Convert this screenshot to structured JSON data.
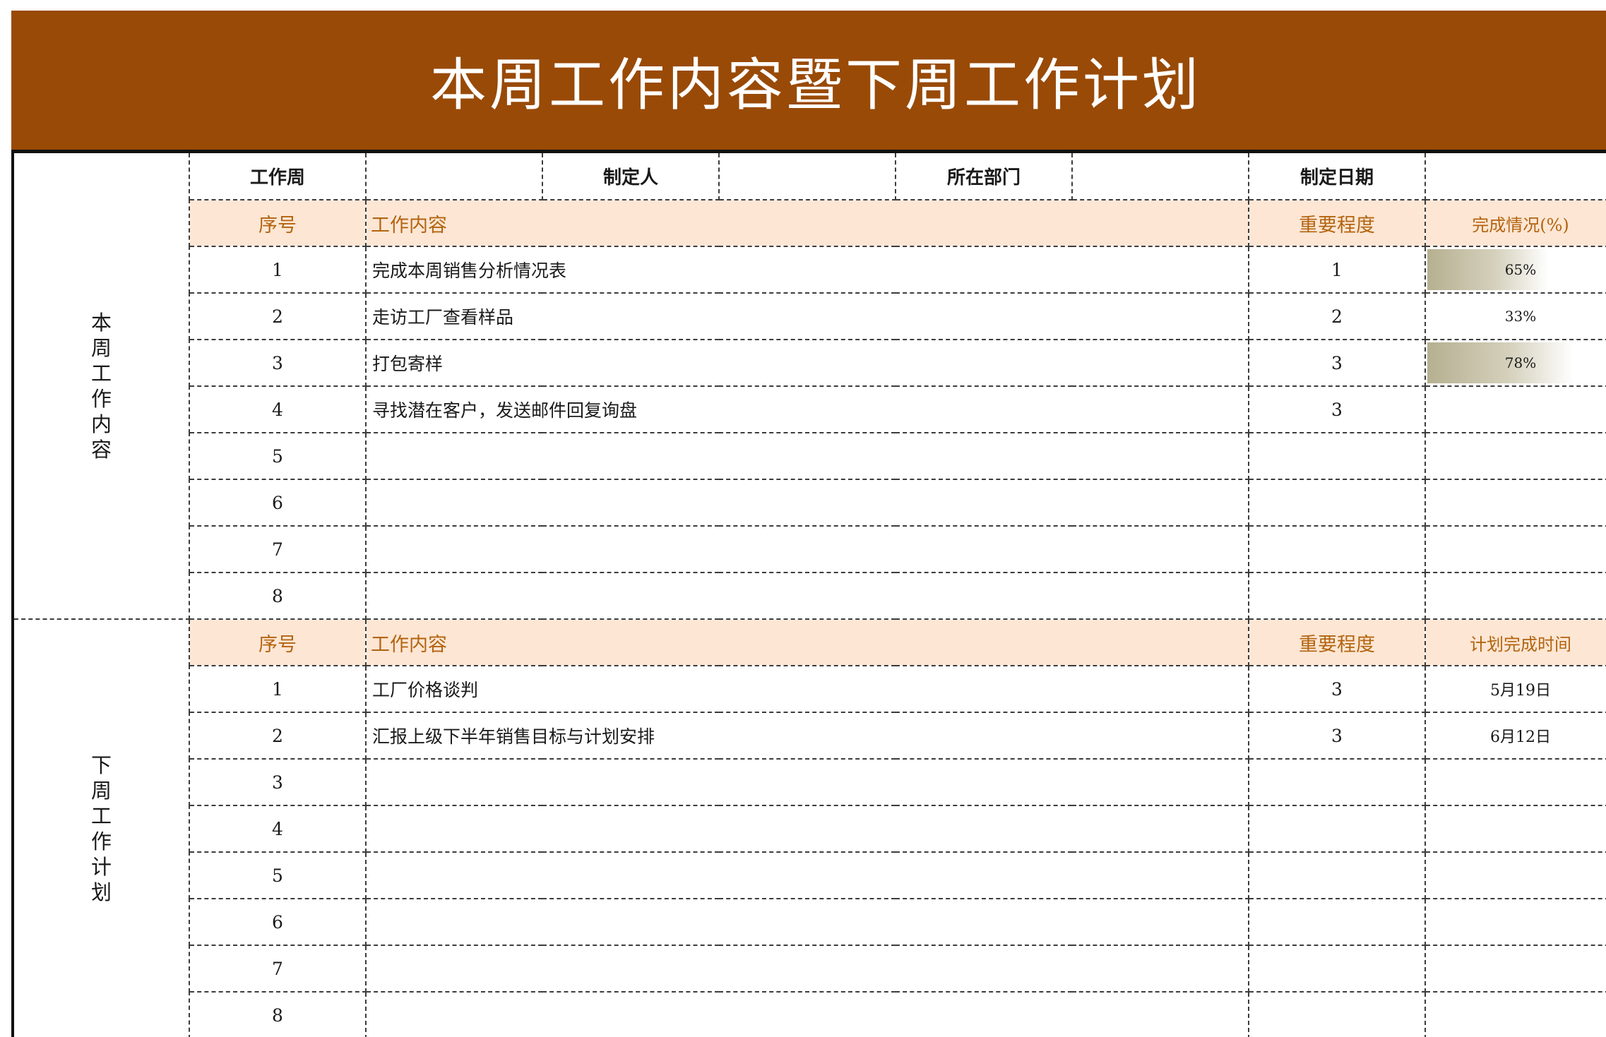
{
  "title": "本周工作内容暨下周工作计划",
  "colors": {
    "title_bg": "#994a06",
    "header_band_bg": "#fde6d4",
    "header_band_text": "#b3640f",
    "progress_bar": "#b6b091"
  },
  "info_row": {
    "work_week_label": "工作周",
    "work_week_value": "",
    "maker_label": "制定人",
    "maker_value": "",
    "department_label": "所在部门",
    "department_value": "",
    "date_label": "制定日期",
    "date_value": ""
  },
  "this_week": {
    "section_label": "本周工作内容",
    "headers": {
      "index": "序号",
      "content": "工作内容",
      "importance": "重要程度",
      "status": "完成情况(%)"
    },
    "rows": [
      {
        "index": "1",
        "content": "完成本周销售分析情况表",
        "importance": "1",
        "status": "65%",
        "progress": 0.65
      },
      {
        "index": "2",
        "content": "走访工厂查看样品",
        "importance": "2",
        "status": "33%",
        "progress": 0
      },
      {
        "index": "3",
        "content": "打包寄样",
        "importance": "3",
        "status": "78%",
        "progress": 0.78
      },
      {
        "index": "4",
        "content": "寻找潜在客户，发送邮件回复询盘",
        "importance": "3",
        "status": "",
        "progress": 0
      },
      {
        "index": "5",
        "content": "",
        "importance": "",
        "status": "",
        "progress": 0
      },
      {
        "index": "6",
        "content": "",
        "importance": "",
        "status": "",
        "progress": 0
      },
      {
        "index": "7",
        "content": "",
        "importance": "",
        "status": "",
        "progress": 0
      },
      {
        "index": "8",
        "content": "",
        "importance": "",
        "status": "",
        "progress": 0
      }
    ]
  },
  "next_week": {
    "section_label": "下周工作计划",
    "headers": {
      "index": "序号",
      "content": "工作内容",
      "importance": "重要程度",
      "planned_time": "计划完成时间"
    },
    "rows": [
      {
        "index": "1",
        "content": "工厂价格谈判",
        "importance": "3",
        "planned_time": "5月19日"
      },
      {
        "index": "2",
        "content": "汇报上级下半年销售目标与计划安排",
        "importance": "3",
        "planned_time": "6月12日"
      },
      {
        "index": "3",
        "content": "",
        "importance": "",
        "planned_time": ""
      },
      {
        "index": "4",
        "content": "",
        "importance": "",
        "planned_time": ""
      },
      {
        "index": "5",
        "content": "",
        "importance": "",
        "planned_time": ""
      },
      {
        "index": "6",
        "content": "",
        "importance": "",
        "planned_time": ""
      },
      {
        "index": "7",
        "content": "",
        "importance": "",
        "planned_time": ""
      },
      {
        "index": "8",
        "content": "",
        "importance": "",
        "planned_time": ""
      }
    ]
  }
}
